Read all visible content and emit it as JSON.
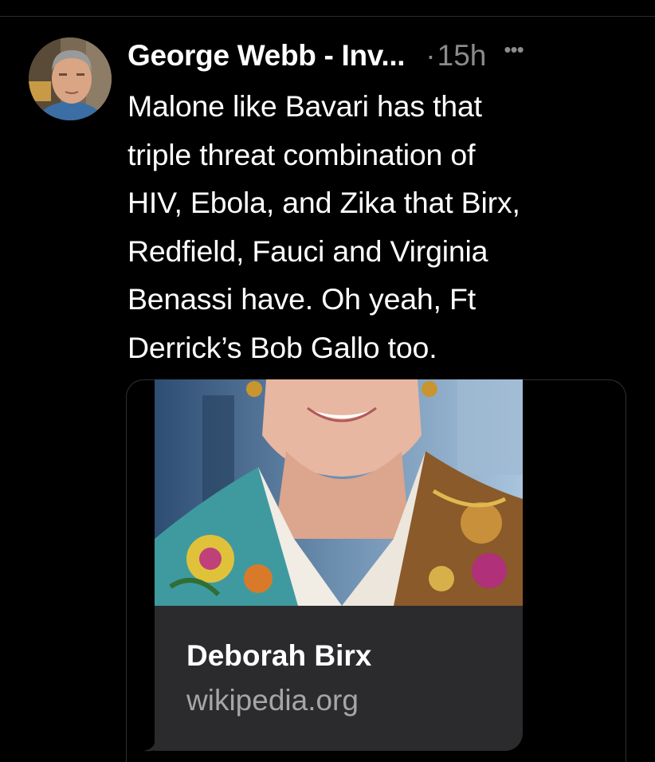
{
  "tweet": {
    "author_name": "George Webb - Inv...",
    "separator": "·",
    "time": "15h",
    "more_icon": "more-horizontal-icon",
    "lines": [
      "Malone like Bavari has that",
      "triple threat combination of",
      "HIV, Ebola, and Zika that Birx,",
      "Redfield, Fauci and Virginia",
      "Benassi have. Oh yeah, Ft",
      "Derrick’s Bob Gallo too."
    ]
  },
  "link_card": {
    "title": "Deborah Birx",
    "domain": "wikipedia.org"
  },
  "colors": {
    "background": "#000000",
    "text": "#ffffff",
    "muted": "#8b8b8b",
    "card_bg": "#2b2b2d",
    "card_domain": "#a6a6a6"
  }
}
